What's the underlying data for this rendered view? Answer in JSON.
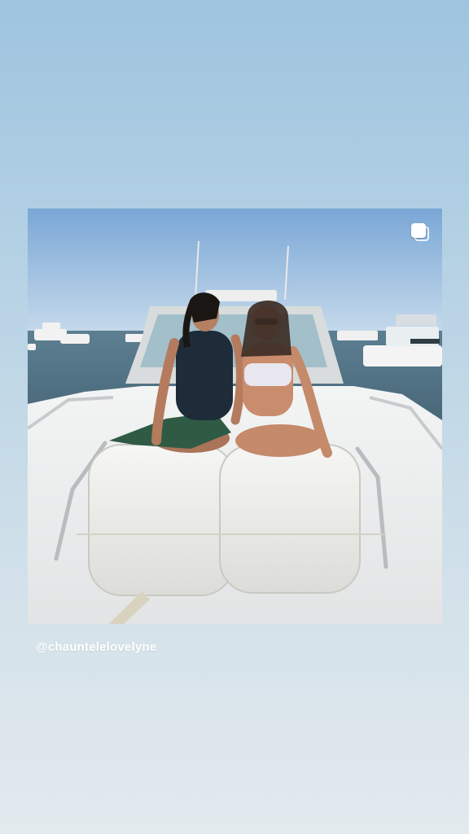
{
  "story": {
    "background_top": "#9ec4df",
    "background_bottom": "#e3eaee",
    "photo": {
      "icon": "multiple-photos-icon"
    },
    "mention": "@chauntelelovelyne"
  }
}
